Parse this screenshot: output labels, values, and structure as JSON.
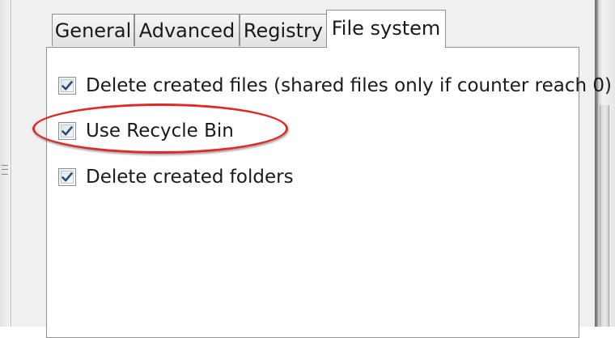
{
  "tabs": [
    {
      "label": "General",
      "active": false
    },
    {
      "label": "Advanced",
      "active": false
    },
    {
      "label": "Registry",
      "active": false
    },
    {
      "label": "File system",
      "active": true
    }
  ],
  "file_system": {
    "options": [
      {
        "label": "Delete created files (shared files only if counter reach 0)",
        "checked": true
      },
      {
        "label": "Use Recycle Bin",
        "checked": true
      },
      {
        "label": "Delete created folders",
        "checked": true
      }
    ]
  },
  "colors": {
    "highlight": "#e02a2a",
    "checkmark": "#2b4a7a"
  },
  "icons": {
    "checkmark": "checkmark-icon",
    "grip": "resize-grip-icon"
  }
}
